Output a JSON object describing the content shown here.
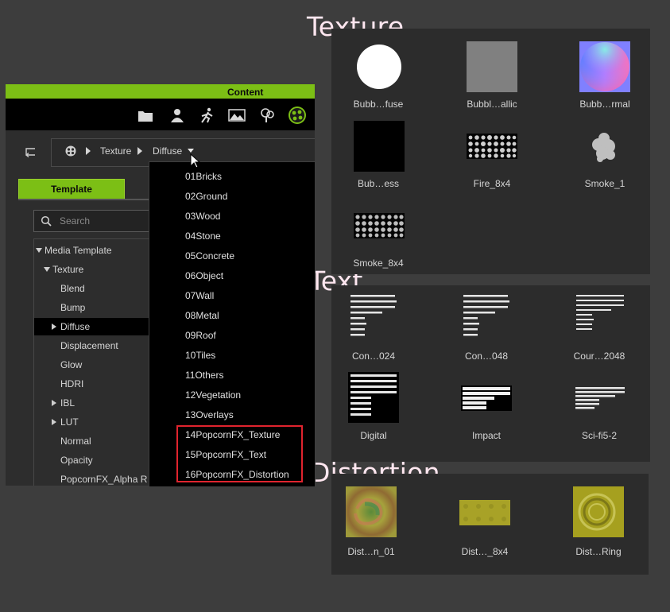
{
  "headings": {
    "texture": "Texture",
    "text": "Text",
    "distortion": "Distortion"
  },
  "content_panel": {
    "header_title": "Content",
    "toolbar_icons": [
      "folder-icon",
      "person-icon",
      "motion-icon",
      "scene-icon",
      "tree-icon",
      "popcorn-fx-icon"
    ],
    "breadcrumb": {
      "items": [
        "Texture",
        "Diffuse"
      ]
    },
    "tab_label": "Template",
    "search_placeholder": "Search",
    "tree": [
      {
        "label": "Media Template",
        "state": "expanded"
      },
      {
        "label": "Texture",
        "state": "expanded"
      },
      {
        "label": "Blend"
      },
      {
        "label": "Bump"
      },
      {
        "label": "Diffuse",
        "state": "collapsed",
        "selected": true
      },
      {
        "label": "Displacement"
      },
      {
        "label": "Glow"
      },
      {
        "label": "HDRI"
      },
      {
        "label": "IBL",
        "state": "collapsed"
      },
      {
        "label": "LUT",
        "state": "collapsed"
      },
      {
        "label": "Normal"
      },
      {
        "label": "Opacity"
      },
      {
        "label": "PopcornFX_Alpha R"
      }
    ]
  },
  "dropdown": {
    "items": [
      "01Bricks",
      "02Ground",
      "03Wood",
      "04Stone",
      "05Concrete",
      "06Object",
      "07Wall",
      "08Metal",
      "09Roof",
      "10Tiles",
      "11Others",
      "12Vegetation",
      "13Overlays",
      "14PopcornFX_Texture",
      "15PopcornFX_Text",
      "16PopcornFX_Distortion"
    ],
    "highlighted": [
      "14PopcornFX_Texture",
      "15PopcornFX_Text",
      "16PopcornFX_Distortion"
    ],
    "highlight_color": "#e0242e"
  },
  "texture_items": [
    {
      "label": "Bubb…fuse",
      "icon": "white-disc-thumbnail"
    },
    {
      "label": "Bubbl…allic",
      "icon": "gray-square-thumbnail"
    },
    {
      "label": "Bubb…rmal",
      "icon": "normal-map-sphere-thumbnail"
    },
    {
      "label": "Bub…ess",
      "icon": "black-square-thumbnail"
    },
    {
      "label": "Fire_8x4",
      "icon": "fire-sprite-sheet-thumbnail"
    },
    {
      "label": "Smoke_1",
      "icon": "smoke-puff-thumbnail"
    },
    {
      "label": "Smoke_8x4",
      "icon": "smoke-sprite-sheet-thumbnail"
    }
  ],
  "text_items": [
    {
      "label": "Con…024",
      "icon": "font-atlas-thumbnail"
    },
    {
      "label": "Con…048",
      "icon": "font-atlas-thumbnail"
    },
    {
      "label": "Cour…2048",
      "icon": "font-atlas-thumbnail"
    },
    {
      "label": "Digital",
      "icon": "font-atlas-thumbnail"
    },
    {
      "label": "Impact",
      "icon": "font-atlas-thumbnail"
    },
    {
      "label": "Sci-fi5-2",
      "icon": "font-atlas-thumbnail"
    }
  ],
  "distortion_items": [
    {
      "label": "Dist…n_01",
      "icon": "swirl-distortion-thumbnail"
    },
    {
      "label": "Dist…_8x4",
      "icon": "grid-distortion-thumbnail"
    },
    {
      "label": "Dist…Ring",
      "icon": "ring-distortion-thumbnail"
    }
  ],
  "colors": {
    "accent": "#7cbf15",
    "background": "#3d3d3d",
    "panel": "#2c2c2c",
    "heading": "#ffe7f0"
  }
}
